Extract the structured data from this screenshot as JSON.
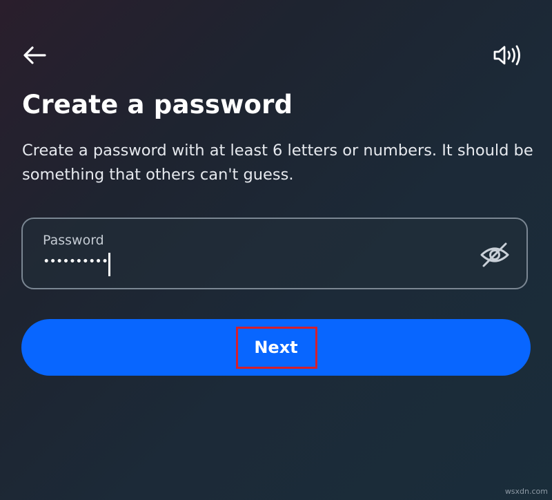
{
  "header": {
    "back_icon": "back-arrow-icon",
    "sound_icon": "speaker-icon"
  },
  "page": {
    "title": "Create a password",
    "description": "Create a password with at least 6 letters or numbers. It should be something that others can't guess."
  },
  "password_field": {
    "label": "Password",
    "masked_value": "••••••••••",
    "visibility_icon": "eye-slash-icon"
  },
  "next_button": {
    "label": "Next",
    "color": "#0866ff"
  },
  "highlight": {
    "color": "#d51f2c"
  },
  "watermark": "wsxdn.com",
  "colors": {
    "background": "#1c2a38",
    "text": "#ffffff",
    "field_border": "#7b8793"
  }
}
